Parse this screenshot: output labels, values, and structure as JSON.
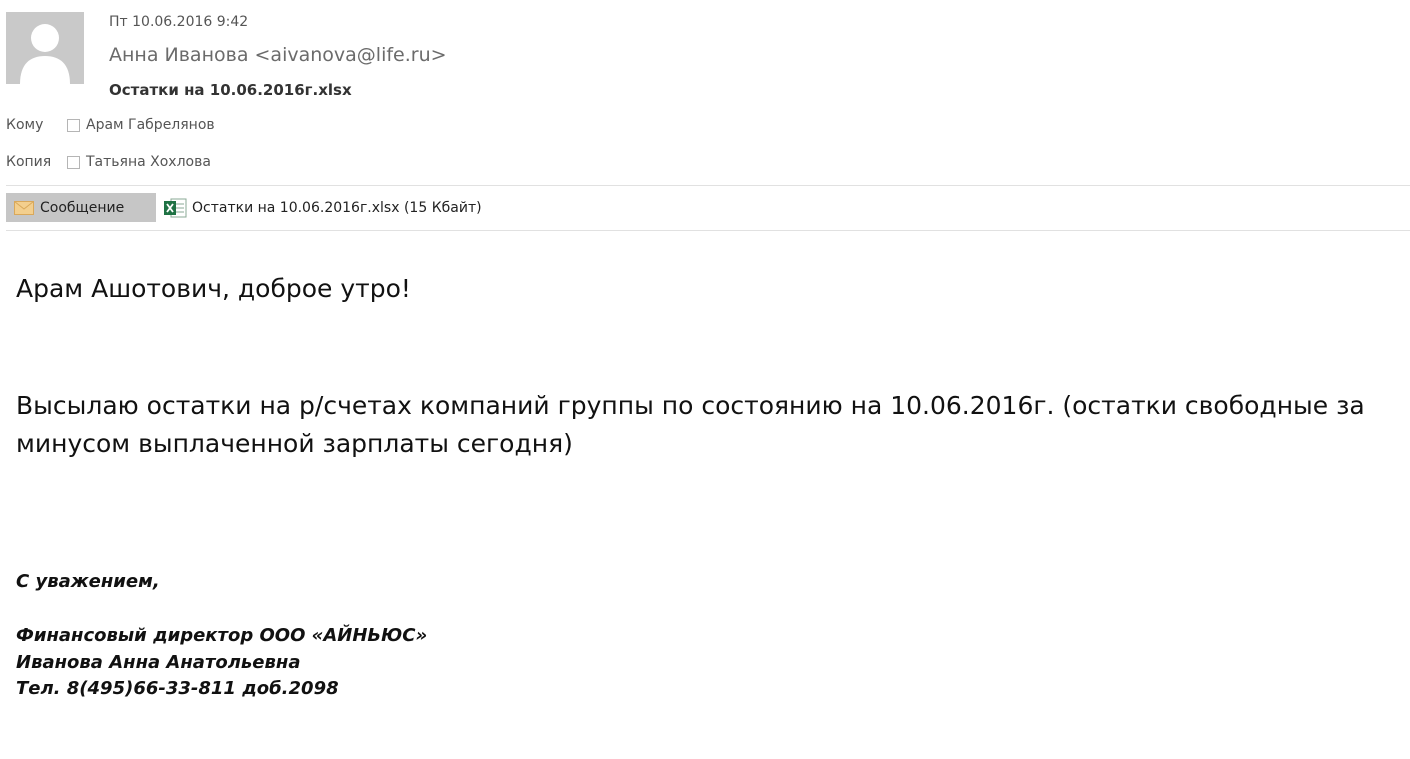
{
  "header": {
    "date": "Пт 10.06.2016 9:42",
    "sender": "Анна Иванова <aivanova@life.ru>",
    "subject": "Остатки на 10.06.2016г.xlsx"
  },
  "recipients": {
    "to_label": "Кому",
    "to": "Арам Габрелянов",
    "cc_label": "Копия",
    "cc": "Татьяна Хохлова"
  },
  "tabs": {
    "message_label": "Сообщение",
    "attachment": "Остатки на 10.06.2016г.xlsx (15 Кбайт)"
  },
  "body": {
    "greeting": "Арам Ашотович, доброе утро!",
    "line1": "Высылаю остатки на р/счетах компаний группы по состоянию на 10.06.2016г. (остатки свободные за",
    "line2": "минусом выплаченной зарплаты сегодня)"
  },
  "signature": {
    "closing": "С уважением,",
    "position": "Финансовый директор ООО «АЙНЬЮС»",
    "name": "Иванова Анна Анатольевна",
    "phone": "Тел. 8(495)66-33-811 доб.2098"
  },
  "colors": {
    "tab_bg": "#c6c6c6",
    "excel_green": "#1f7244",
    "envelope": "#e8b96a"
  }
}
